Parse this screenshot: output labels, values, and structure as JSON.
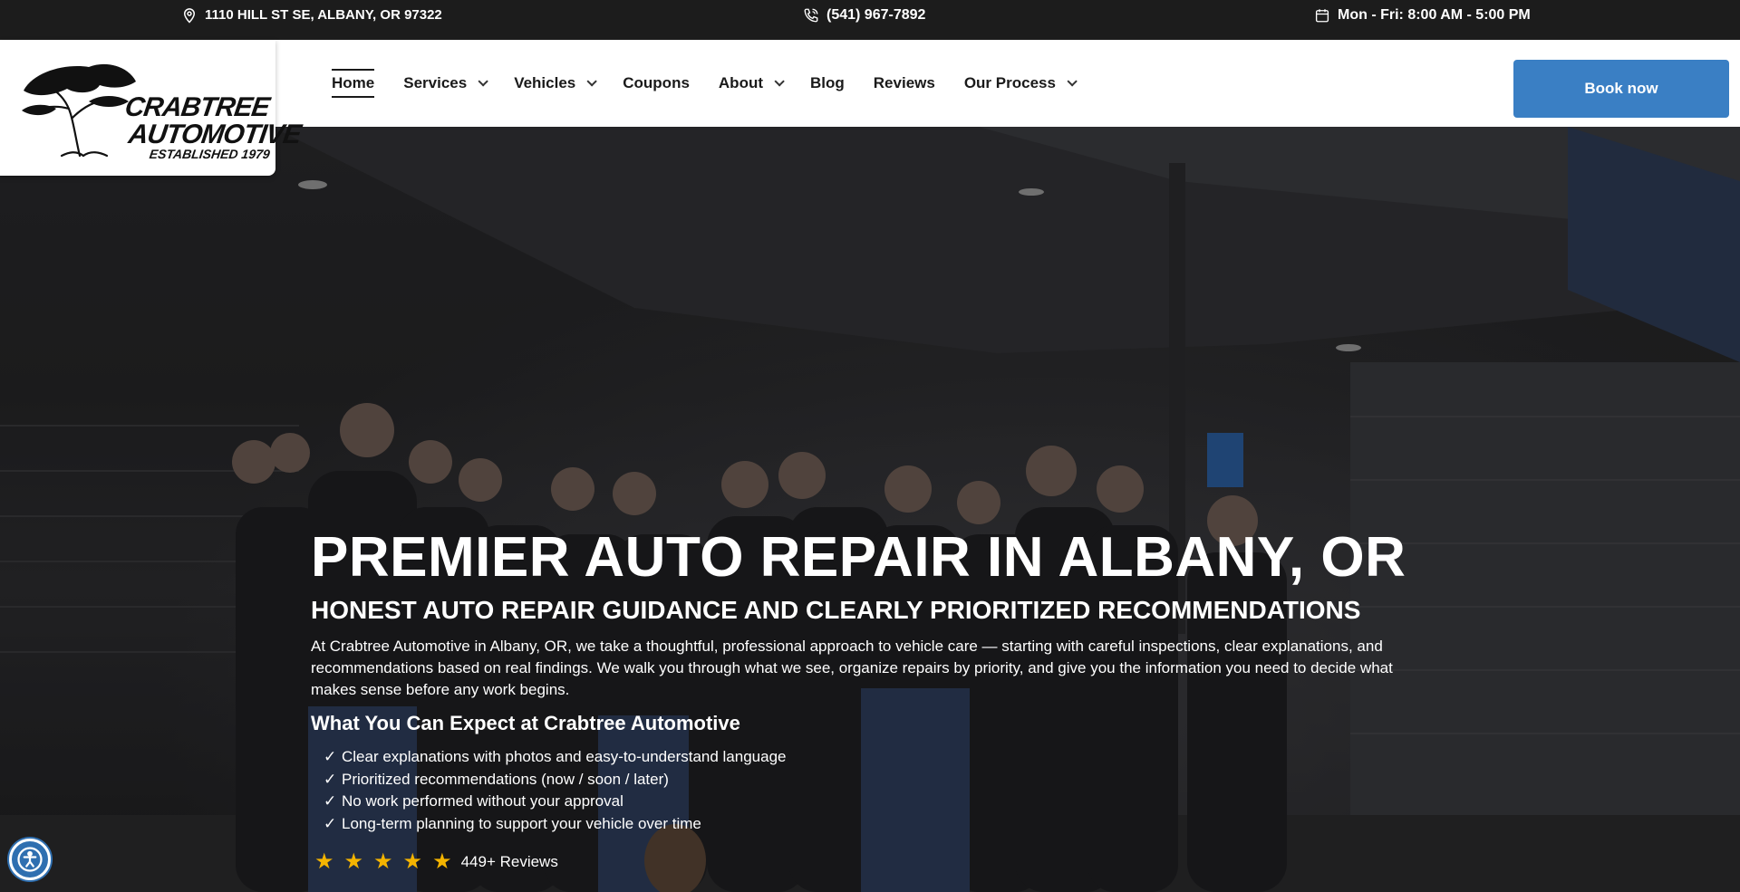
{
  "topbar": {
    "address": "1110 HILL ST SE, ALBANY, OR 97322",
    "phone": "(541) 967-7892",
    "hours": "Mon - Fri: 8:00 AM - 5:00 PM",
    "icons": {
      "address": "map-pin-icon",
      "phone": "phone-icon",
      "hours": "calendar-icon"
    }
  },
  "logo": {
    "line1": "CRABTREE",
    "line2": "AUTOMOTIVE",
    "line3": "ESTABLISHED 1979"
  },
  "nav": {
    "items": [
      {
        "label": "Home",
        "active": true,
        "dropdown": false
      },
      {
        "label": "Services",
        "dropdown": true
      },
      {
        "label": "Vehicles",
        "dropdown": true
      },
      {
        "label": "Coupons",
        "dropdown": false
      },
      {
        "label": "About",
        "dropdown": true
      },
      {
        "label": "Blog",
        "dropdown": false
      },
      {
        "label": "Reviews",
        "dropdown": false
      },
      {
        "label": "Our Process",
        "dropdown": true
      }
    ],
    "book_label": "Book now"
  },
  "hero": {
    "title": "PREMIER AUTO REPAIR IN  ALBANY, OR",
    "subtitle": "HONEST AUTO REPAIR GUIDANCE AND CLEARLY PRIORITIZED RECOMMENDATIONS",
    "description": "At Crabtree Automotive in Albany, OR, we take a thoughtful, professional approach to vehicle care — starting with careful inspections, clear explanations, and recommendations based on real findings. We walk you through what we see, organize repairs by priority, and give you the information you need to decide what makes sense before any work begins.",
    "expect_heading": "What You Can Expect at Crabtree Automotive",
    "checklist": [
      "Clear explanations with photos and easy-to-understand language",
      "Prioritized recommendations (now / soon / later)",
      "No work performed without your approval",
      "Long-term planning to support your vehicle over time"
    ],
    "check_mark": "✓",
    "rating": {
      "stars": 5,
      "reviews_label": "449+ Reviews"
    }
  },
  "colors": {
    "topbar_bg": "#1c1c1c",
    "accent": "#3a7fc4",
    "star": "#f4b400"
  }
}
